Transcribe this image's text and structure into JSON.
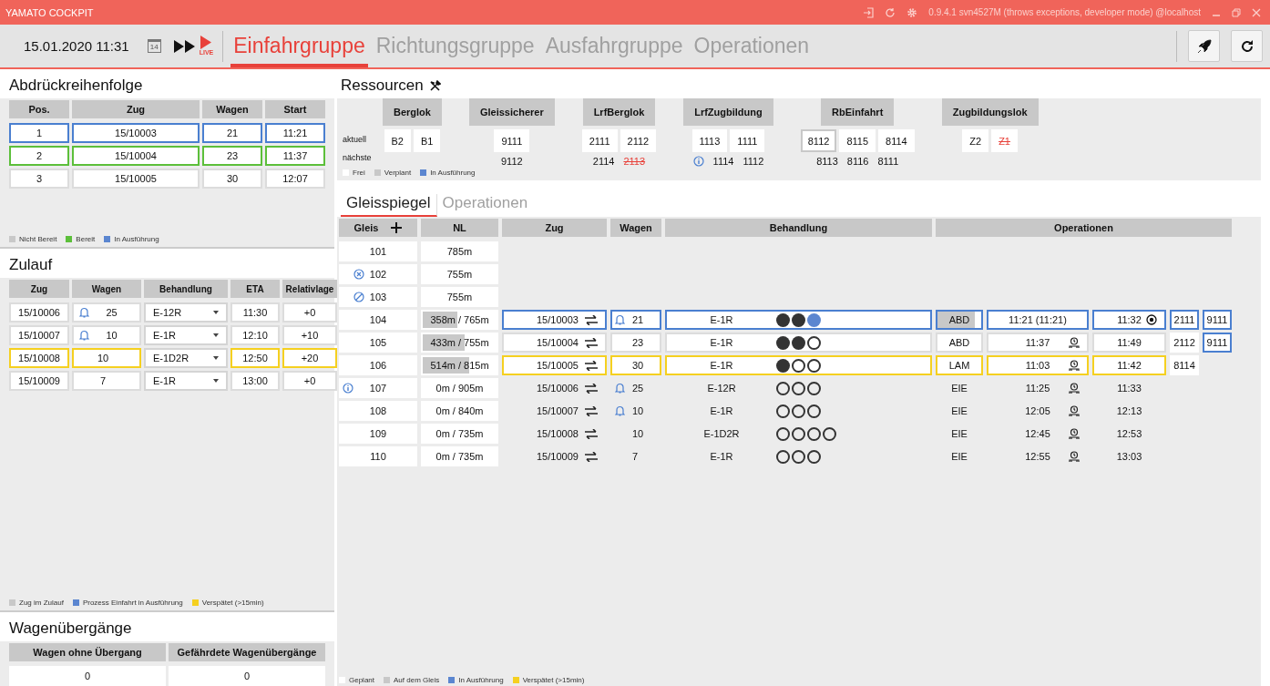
{
  "window": {
    "title": "YAMATO COCKPIT",
    "version": "0.9.4.1 svn4527M (throws exceptions, developer mode) @localhost"
  },
  "header": {
    "datetime": "15.01.2020 11:31",
    "calendar_day": "14",
    "live_label": "LIVE",
    "tabs": [
      {
        "label": "Einfahrgruppe",
        "selected": true
      },
      {
        "label": "Richtungsgruppe",
        "selected": false
      },
      {
        "label": "Ausfahrgruppe",
        "selected": false
      },
      {
        "label": "Operationen",
        "selected": false
      }
    ]
  },
  "abdrueck": {
    "title": "Abdrückreihenfolge",
    "columns": [
      "Pos.",
      "Zug",
      "Wagen",
      "Start"
    ],
    "rows": [
      {
        "kind": "running",
        "cells": [
          "1",
          "15/10003",
          "21",
          "11:21"
        ]
      },
      {
        "kind": "ready",
        "cells": [
          "2",
          "15/10004",
          "23",
          "11:37"
        ]
      },
      {
        "kind": "waiting",
        "cells": [
          "3",
          "15/10005",
          "30",
          "12:07"
        ]
      }
    ],
    "legend": [
      {
        "label": "Nicht Bereit",
        "color": "#c8c8c8"
      },
      {
        "label": "Bereit",
        "color": "#5cbf3a"
      },
      {
        "label": "In Ausführung",
        "color": "#5b86d0"
      }
    ]
  },
  "zulauf": {
    "title": "Zulauf",
    "columns": [
      "Zug",
      "Wagen",
      "Behandlung",
      "ETA",
      "Relativlage"
    ],
    "rows": [
      {
        "kind": "incoming",
        "zug": "15/10006",
        "bell": true,
        "wagen": "25",
        "behandlung": "E-12R",
        "eta": "11:30",
        "relativlage": "+0"
      },
      {
        "kind": "incoming",
        "zug": "15/10007",
        "bell": true,
        "wagen": "10",
        "behandlung": "E-1R",
        "eta": "12:10",
        "relativlage": "+10"
      },
      {
        "kind": "late",
        "zug": "15/10008",
        "bell": false,
        "wagen": "10",
        "behandlung": "E-1D2R",
        "eta": "12:50",
        "relativlage": "+20"
      },
      {
        "kind": "incoming",
        "zug": "15/10009",
        "bell": false,
        "wagen": "7",
        "behandlung": "E-1R",
        "eta": "13:00",
        "relativlage": "+0"
      }
    ],
    "legend": [
      {
        "label": "Zug im Zulauf",
        "color": "#c8c8c8"
      },
      {
        "label": "Prozess Einfahrt in Ausführung",
        "color": "#5b86d0"
      },
      {
        "label": "Verspätet (>15min)",
        "color": "#f5d020"
      }
    ]
  },
  "wagenuebergaenge": {
    "title": "Wagenübergänge",
    "columns": [
      "Wagen ohne Übergang",
      "Gefährdete Wagenübergänge"
    ],
    "values": [
      "0",
      "0"
    ]
  },
  "ressourcen": {
    "title": "Ressourcen",
    "row_labels": [
      "aktuell",
      "nächste"
    ],
    "groups": [
      {
        "name": "Berglok",
        "info": false,
        "current": [
          {
            "label": "B2",
            "kind": "running",
            "struck": false
          },
          {
            "label": "B1",
            "kind": "free",
            "struck": false
          }
        ]
      },
      {
        "name": "Gleissicherer",
        "info": false,
        "current": [
          {
            "label": "9111",
            "kind": "running",
            "struck": false
          }
        ],
        "next": [
          {
            "label": "9112",
            "struck": false
          }
        ]
      },
      {
        "name": "LrfBerglok",
        "info": false,
        "current": [
          {
            "label": "2111",
            "kind": "running",
            "struck": false
          },
          {
            "label": "2112",
            "kind": "free",
            "struck": false
          }
        ],
        "next": [
          {
            "label": "2114",
            "struck": false
          },
          {
            "label": "2113",
            "struck": true
          }
        ]
      },
      {
        "name": "LrfZugbildung",
        "info": true,
        "current": [
          {
            "label": "1113",
            "kind": "free",
            "struck": false
          },
          {
            "label": "1111",
            "kind": "free",
            "struck": false
          }
        ],
        "next": [
          {
            "label": "1114",
            "struck": false
          },
          {
            "label": "1112",
            "struck": false
          }
        ]
      },
      {
        "name": "RbEinfahrt",
        "info": false,
        "current": [
          {
            "label": "8112",
            "kind": "planned",
            "struck": false
          },
          {
            "label": "8115",
            "kind": "free",
            "struck": false
          },
          {
            "label": "8114",
            "kind": "free",
            "struck": false
          }
        ],
        "next": [
          {
            "label": "8113",
            "struck": false
          },
          {
            "label": "8116",
            "struck": false
          },
          {
            "label": "8111",
            "struck": false
          }
        ]
      },
      {
        "name": "Zugbildungslok",
        "info": false,
        "current": [
          {
            "label": "Z2",
            "kind": "free",
            "struck": false
          },
          {
            "label": "Z1",
            "kind": "free",
            "struck": true
          }
        ]
      }
    ],
    "legend": [
      {
        "label": "Frei",
        "color": "#ffffff"
      },
      {
        "label": "Verplant",
        "color": "#c8c8c8"
      },
      {
        "label": "In Ausführung",
        "color": "#5b86d0"
      }
    ]
  },
  "gleisspiegel": {
    "tabs": [
      {
        "label": "Gleisspiegel",
        "selected": true
      },
      {
        "label": "Operationen",
        "selected": false
      }
    ],
    "columns": [
      "Gleis",
      "NL",
      "Zug",
      "Wagen",
      "Behandlung",
      "Operationen"
    ],
    "rows": [
      {
        "kind": "open",
        "gleis": "101",
        "nl": "785m"
      },
      {
        "kind": "closed",
        "gleis": "102",
        "nl": "755m"
      },
      {
        "kind": "blocked",
        "gleis": "103",
        "nl": "755m"
      },
      {
        "kind": "open",
        "gleis": "104",
        "nl": "358m / 765m",
        "level": 0.47,
        "train": {
          "kind": "running",
          "zug": "15/10003",
          "bell": true,
          "wagen": "21",
          "behandlung": "E-1R",
          "steps": [
            {
              "kind": "done"
            },
            {
              "kind": "done"
            },
            {
              "kind": "active"
            }
          ],
          "op": {
            "code": "ABD",
            "level": 0.85,
            "start": "11:21  (11:21)",
            "start_clock": false,
            "end": "11:32",
            "end_target": true,
            "resources": [
              {
                "label": "2111",
                "kind": "running"
              },
              {
                "label": "9111",
                "kind": "running"
              }
            ]
          }
        }
      },
      {
        "kind": "open",
        "gleis": "105",
        "nl": "433m / 755m",
        "level": 0.57,
        "train": {
          "kind": "on_track",
          "zug": "15/10004",
          "bell": false,
          "wagen": "23",
          "behandlung": "E-1R",
          "steps": [
            {
              "kind": "done"
            },
            {
              "kind": "done"
            },
            {
              "kind": "open"
            }
          ],
          "op": {
            "code": "ABD",
            "start": "11:37",
            "start_clock": true,
            "end": "11:49",
            "end_target": false,
            "resources": [
              {
                "label": "2112",
                "kind": "free"
              },
              {
                "label": "9111",
                "kind": "running"
              }
            ]
          }
        }
      },
      {
        "kind": "open",
        "gleis": "106",
        "nl": "514m / 815m",
        "level": 0.63,
        "train": {
          "kind": "late",
          "zug": "15/10005",
          "bell": false,
          "wagen": "30",
          "behandlung": "E-1R",
          "steps": [
            {
              "kind": "done"
            },
            {
              "kind": "open"
            },
            {
              "kind": "open"
            }
          ],
          "op": {
            "code": "LAM",
            "start": "11:03",
            "start_clock": true,
            "end": "11:42",
            "end_target": false,
            "resources": [
              {
                "label": "8114",
                "kind": "free"
              }
            ]
          }
        }
      },
      {
        "kind": "info",
        "gleis": "107",
        "nl": "0m / 905m",
        "train": {
          "kind": "planned",
          "zug": "15/10006",
          "bell": true,
          "wagen": "25",
          "behandlung": "E-12R",
          "steps": [
            {
              "kind": "open"
            },
            {
              "kind": "open"
            },
            {
              "kind": "open"
            }
          ],
          "op": {
            "code": "EIE",
            "start": "11:25",
            "start_clock": true,
            "end": "11:33",
            "end_target": false
          }
        }
      },
      {
        "kind": "open",
        "gleis": "108",
        "nl": "0m / 840m",
        "train": {
          "kind": "planned",
          "zug": "15/10007",
          "bell": true,
          "wagen": "10",
          "behandlung": "E-1R",
          "steps": [
            {
              "kind": "open"
            },
            {
              "kind": "open"
            },
            {
              "kind": "open"
            }
          ],
          "op": {
            "code": "EIE",
            "start": "12:05",
            "start_clock": true,
            "end": "12:13",
            "end_target": false
          }
        }
      },
      {
        "kind": "open",
        "gleis": "109",
        "nl": "0m / 735m",
        "train": {
          "kind": "planned",
          "zug": "15/10008",
          "bell": false,
          "wagen": "10",
          "behandlung": "E-1D2R",
          "steps": [
            {
              "kind": "open"
            },
            {
              "kind": "open"
            },
            {
              "kind": "open"
            },
            {
              "kind": "open"
            }
          ],
          "op": {
            "code": "EIE",
            "start": "12:45",
            "start_clock": true,
            "end": "12:53",
            "end_target": false
          }
        }
      },
      {
        "kind": "open",
        "gleis": "110",
        "nl": "0m / 735m",
        "train": {
          "kind": "planned",
          "zug": "15/10009",
          "bell": false,
          "wagen": "7",
          "behandlung": "E-1R",
          "steps": [
            {
              "kind": "open"
            },
            {
              "kind": "open"
            },
            {
              "kind": "open"
            }
          ],
          "op": {
            "code": "EIE",
            "start": "12:55",
            "start_clock": true,
            "end": "13:03",
            "end_target": false
          }
        }
      }
    ],
    "legend": [
      {
        "label": "Geplant",
        "color": "#ffffff"
      },
      {
        "label": "Auf dem Gleis",
        "color": "#c8c8c8"
      },
      {
        "label": "In Ausführung",
        "color": "#5b86d0"
      },
      {
        "label": "Verspätet (>15min)",
        "color": "#f5d020"
      }
    ]
  }
}
